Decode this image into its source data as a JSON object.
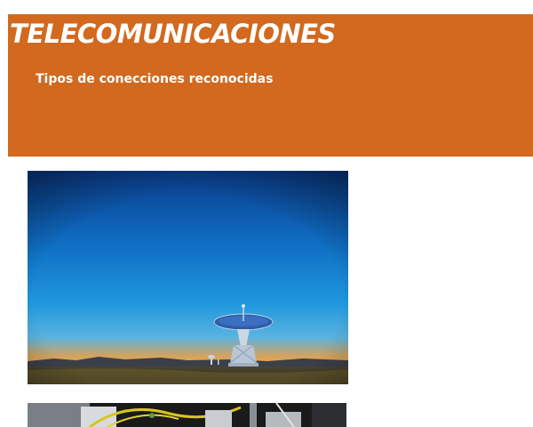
{
  "header": {
    "title": "TELECOMUNICACIONES",
    "subtitle": "Tipos de conecciones reconocidas",
    "background_color": "#d2691e",
    "text_color": "#ffffff"
  },
  "images": [
    {
      "name": "radio-telescope-photo"
    },
    {
      "name": "network-cables-photo"
    }
  ]
}
